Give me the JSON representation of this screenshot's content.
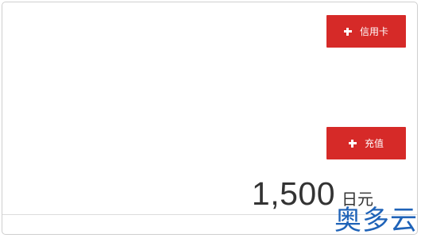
{
  "buttons": {
    "credit_card_label": "信用卡",
    "charge_label": "充值"
  },
  "balance": {
    "amount": "1,500",
    "unit": "日元"
  },
  "watermark": "奥多云",
  "colors": {
    "accent": "#d62a28",
    "text": "#333333",
    "border": "#cfcfcf",
    "watermark": "#1f63b8"
  },
  "icons": [
    "plus-icon"
  ]
}
